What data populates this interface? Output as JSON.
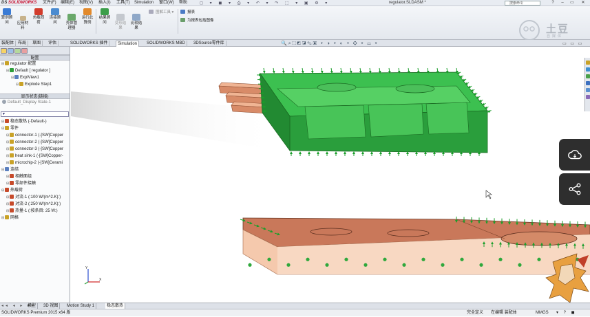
{
  "app": {
    "logo_prefix": "DS ",
    "logo_name": "SOLIDWORKS",
    "document_title": "regulator.SLDASM *",
    "search_placeholder": "搜索命令"
  },
  "menu": [
    "文件(F)",
    "编辑(E)",
    "视图(V)",
    "插入(I)",
    "工具(T)",
    "Simulation",
    "窗口(W)",
    "帮助"
  ],
  "ribbon": {
    "buttons": [
      {
        "label": "算例顾\n问"
      },
      {
        "label": "热载荷\n荷"
      },
      {
        "label": "应用材\n料"
      },
      {
        "label": "连接顾\n问"
      },
      {
        "label": "壳体管\n理器"
      },
      {
        "label": "运行此\n算例"
      },
      {
        "label": "结果顾\n问"
      },
      {
        "label": "变形结\n果"
      },
      {
        "label": "比较结\n果"
      }
    ],
    "small": [
      "图解工具",
      "报表",
      "为报表包括图像"
    ]
  },
  "tabs": [
    {
      "label": "装配体",
      "active": false
    },
    {
      "label": "布局",
      "active": false
    },
    {
      "label": "草图",
      "active": false
    },
    {
      "label": "评估",
      "active": false
    },
    {
      "label": "SOLIDWORKS 插件",
      "active": false
    },
    {
      "label": "Simulation",
      "active": true
    },
    {
      "label": "SOLIDWORKS MBD",
      "active": false
    },
    {
      "label": "3DSource零件库",
      "active": false
    }
  ],
  "left_panel": {
    "config_header": "配置",
    "config_tree": [
      {
        "label": "regulator 配置",
        "level": 0,
        "color": "#c9a227"
      },
      {
        "label": "Default [ regulator ]",
        "level": 1,
        "color": "#2e9e3a"
      },
      {
        "label": "ExplView1",
        "level": 2,
        "color": "#5a7fbf"
      },
      {
        "label": "Explode Step1",
        "level": 3,
        "color": "#c9a227"
      }
    ],
    "display_header": "显示状态(链接)",
    "display_state": "Default_Display State-1",
    "filter_text": "▼",
    "study_tree": [
      {
        "label": "稳态散热 (-Default-)",
        "level": 0,
        "color": "#c64a2a"
      },
      {
        "label": "零件",
        "level": 0,
        "color": "#c9a227"
      },
      {
        "label": "connector-1 (-[SW]Copper",
        "level": 1,
        "color": "#c9a227"
      },
      {
        "label": "connector-2 (-[SW]Copper",
        "level": 1,
        "color": "#c9a227"
      },
      {
        "label": "connector-3 (-[SW]Copper",
        "level": 1,
        "color": "#c9a227"
      },
      {
        "label": "heat sink-1 (-[SW]Copper-",
        "level": 1,
        "color": "#c9a227"
      },
      {
        "label": "microchip-2 (-[SW]Cerami",
        "level": 1,
        "color": "#c9a227"
      },
      {
        "label": "连结",
        "level": 0,
        "color": "#5a7fbf"
      },
      {
        "label": "相触面组",
        "level": 1,
        "color": "#c64a2a"
      },
      {
        "label": "零部件接触",
        "level": 1,
        "color": "#c64a2a"
      },
      {
        "label": "热载荷",
        "level": 0,
        "color": "#c64a2a"
      },
      {
        "label": "对流-1 (:100 W/(m^2.K):)",
        "level": 1,
        "color": "#c64a2a"
      },
      {
        "label": "对流-2 (:250 W/(m^2.K):)",
        "level": 1,
        "color": "#c64a2a"
      },
      {
        "label": "热量-1 (:按条目: 25 W:)",
        "level": 1,
        "color": "#c64a2a"
      },
      {
        "label": "网格",
        "level": 0,
        "color": "#c9a227"
      }
    ]
  },
  "bottom_tabs": [
    {
      "label": "模型",
      "active": false
    },
    {
      "label": "3D 视图",
      "active": false
    },
    {
      "label": "Motion Study 1",
      "active": false
    },
    {
      "label": "稳态散热",
      "active": true
    }
  ],
  "status_bar": {
    "product": "SOLIDWORKS Premium 2015 x64 版",
    "state": "完全定义",
    "editing": "在编辑 装配体",
    "units": "MMGS"
  },
  "watermark": {
    "text": "土豆",
    "sub": "自媒体"
  },
  "colors": {
    "accent": "#c8102e",
    "heatsink": "#2fb84a",
    "copper": "#e8a68a",
    "arrow": "#1a9e2a"
  }
}
